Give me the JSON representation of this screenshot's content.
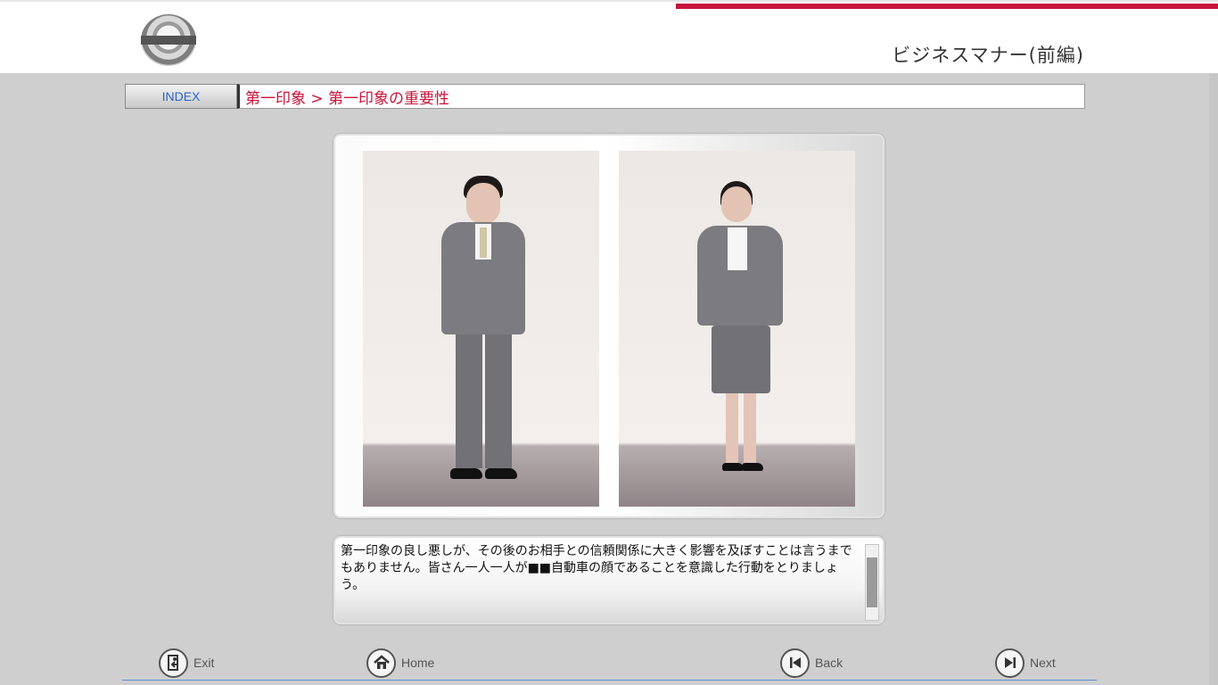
{
  "header": {
    "course_title": "ビジネスマナー(前編)"
  },
  "breadcrumb": {
    "index_label": "INDEX",
    "path": "第一印象 > 第一印象の重要性"
  },
  "narration": {
    "text": "第一印象の良し悪しが、その後のお相手との信頼関係に大きく影響を及ぼすことは言うまでもありません。皆さん一人一人が■■自動車の顔であることを意識した行動をとりましょう。"
  },
  "footer": {
    "exit_label": "Exit",
    "home_label": "Home",
    "back_label": "Back",
    "next_label": "Next"
  },
  "icons": {
    "exit": "exit-icon",
    "home": "home-icon",
    "back": "back-icon",
    "next": "next-icon"
  },
  "colors": {
    "accent_red": "#c8143c",
    "index_text": "#2a63c8",
    "footer_line": "#5a8fd8"
  }
}
